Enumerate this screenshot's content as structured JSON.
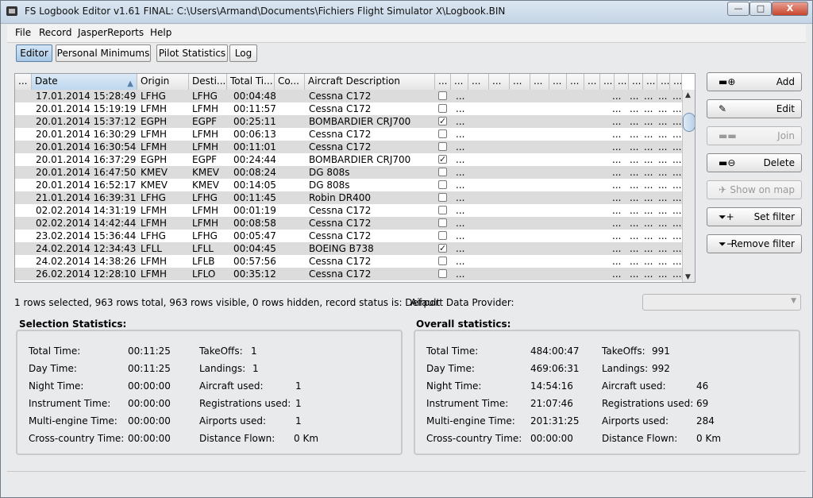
{
  "window": {
    "title": "FS Logbook Editor  v1.61 FINAL: C:\\Users\\Armand\\Documents\\Fichiers Flight Simulator X\\Logbook.BIN",
    "minimize": "—",
    "maximize": "□",
    "close": "X"
  },
  "menu": [
    "File",
    "Record",
    "JasperReports",
    "Help"
  ],
  "tabs": [
    "Editor",
    "Personal Minimums",
    "Pilot Statistics",
    "Log"
  ],
  "table": {
    "columns": [
      "...",
      "Date",
      "Origin",
      "Desti...",
      "Total Ti...",
      "Co...",
      "Aircraft Description",
      "...",
      "...",
      "...",
      "...",
      "...",
      "...",
      "...",
      "...",
      "...",
      "...",
      "...",
      "...",
      "...",
      "...",
      "..."
    ],
    "rows": [
      {
        "date": "17.01.2014 15:28:49",
        "origin": "LFHG",
        "dest": "LFHG",
        "total": "00:04:48",
        "aircraft": "Cessna C172",
        "check": ""
      },
      {
        "date": "20.01.2014 15:19:19",
        "origin": "LFMH",
        "dest": "LFMH",
        "total": "00:11:57",
        "aircraft": "Cessna C172",
        "check": ""
      },
      {
        "date": "20.01.2014 15:37:12",
        "origin": "EGPH",
        "dest": "EGPF",
        "total": "00:25:11",
        "aircraft": "BOMBARDIER CRJ700",
        "check": "✓"
      },
      {
        "date": "20.01.2014 16:30:29",
        "origin": "LFMH",
        "dest": "LFMH",
        "total": "00:06:13",
        "aircraft": "Cessna C172",
        "check": ""
      },
      {
        "date": "20.01.2014 16:30:54",
        "origin": "LFMH",
        "dest": "LFMH",
        "total": "00:11:01",
        "aircraft": "Cessna C172",
        "check": ""
      },
      {
        "date": "20.01.2014 16:37:29",
        "origin": "EGPH",
        "dest": "EGPF",
        "total": "00:24:44",
        "aircraft": "BOMBARDIER CRJ700",
        "check": "✓"
      },
      {
        "date": "20.01.2014 16:47:50",
        "origin": "KMEV",
        "dest": "KMEV",
        "total": "00:08:24",
        "aircraft": "DG 808s",
        "check": ""
      },
      {
        "date": "20.01.2014 16:52:17",
        "origin": "KMEV",
        "dest": "KMEV",
        "total": "00:14:05",
        "aircraft": "DG 808s",
        "check": ""
      },
      {
        "date": "21.01.2014 16:39:31",
        "origin": "LFHG",
        "dest": "LFHG",
        "total": "00:11:45",
        "aircraft": "Robin DR400",
        "check": ""
      },
      {
        "date": "02.02.2014 14:31:19",
        "origin": "LFMH",
        "dest": "LFMH",
        "total": "00:01:19",
        "aircraft": "Cessna C172",
        "check": ""
      },
      {
        "date": "02.02.2014 14:42:44",
        "origin": "LFMH",
        "dest": "LFMH",
        "total": "00:08:58",
        "aircraft": "Cessna C172",
        "check": ""
      },
      {
        "date": "23.02.2014 15:36:44",
        "origin": "LFHG",
        "dest": "LFHG",
        "total": "00:05:47",
        "aircraft": "Cessna C172",
        "check": ""
      },
      {
        "date": "24.02.2014 12:34:43",
        "origin": "LFLL",
        "dest": "LFLL",
        "total": "00:04:45",
        "aircraft": "BOEING B738",
        "check": "✓"
      },
      {
        "date": "24.02.2014 14:38:26",
        "origin": "LFMH",
        "dest": "LFLB",
        "total": "00:57:56",
        "aircraft": "Cessna C172",
        "check": ""
      },
      {
        "date": "26.02.2014 12:28:10",
        "origin": "LFMH",
        "dest": "LFLO",
        "total": "00:35:12",
        "aircraft": "Cessna C172",
        "check": ""
      }
    ],
    "ellipsis": "..."
  },
  "side_buttons": [
    "Add",
    "Edit",
    "Join",
    "Delete",
    "Show on map",
    "Set filter",
    "Remove filter"
  ],
  "status_text": "1 rows selected, 963 rows total, 963 rows visible, 0 rows hidden, record status is: Default",
  "provider_label": "Airport Data Provider:",
  "selection": {
    "title": "Selection Statistics:",
    "left": [
      {
        "label": "Total Time:",
        "value": "00:11:25"
      },
      {
        "label": "Day Time:",
        "value": "00:11:25"
      },
      {
        "label": "Night Time:",
        "value": "00:00:00"
      },
      {
        "label": "Instrument Time:",
        "value": "00:00:00"
      },
      {
        "label": "Multi-engine Time:",
        "value": "00:00:00"
      },
      {
        "label": "Cross-country Time:",
        "value": "00:00:00"
      }
    ],
    "right": [
      {
        "label": "TakeOffs:",
        "value": "1"
      },
      {
        "label": "Landings:",
        "value": "1"
      },
      {
        "label": "Aircraft used:",
        "value": "1"
      },
      {
        "label": "Registrations used:",
        "value": "1"
      },
      {
        "label": "Airports used:",
        "value": "1"
      },
      {
        "label": "Distance Flown:",
        "value": "0 Km"
      }
    ]
  },
  "overall": {
    "title": "Overall statistics:",
    "left": [
      {
        "label": "Total Time:",
        "value": "484:00:47"
      },
      {
        "label": "Day Time:",
        "value": "469:06:31"
      },
      {
        "label": "Night Time:",
        "value": "14:54:16"
      },
      {
        "label": "Instrument Time:",
        "value": "21:07:46"
      },
      {
        "label": "Multi-engine Time:",
        "value": "201:31:25"
      },
      {
        "label": "Cross-country Time:",
        "value": "00:00:00"
      }
    ],
    "right": [
      {
        "label": "TakeOffs:",
        "value": "991"
      },
      {
        "label": "Landings:",
        "value": "992"
      },
      {
        "label": "Aircraft used:",
        "value": "46"
      },
      {
        "label": "Registrations used:",
        "value": "69"
      },
      {
        "label": "Airports used:",
        "value": "284"
      },
      {
        "label": "Distance Flown:",
        "value": "0 Km"
      }
    ]
  }
}
